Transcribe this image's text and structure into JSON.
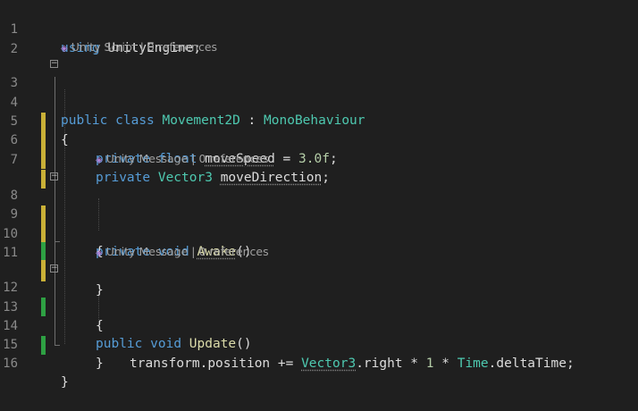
{
  "lines": [
    {
      "n": "1",
      "tokens": [
        {
          "t": "using",
          "c": "kw"
        },
        {
          "t": " UnityEngine;",
          "c": "id"
        }
      ]
    },
    {
      "n": "2",
      "tokens": []
    },
    {
      "n": "3",
      "tokens": [
        {
          "t": "public",
          "c": "kw"
        },
        {
          "t": " ",
          "c": "id"
        },
        {
          "t": "class",
          "c": "kw"
        },
        {
          "t": " ",
          "c": "id"
        },
        {
          "t": "Movement2D",
          "c": "ty"
        },
        {
          "t": " : ",
          "c": "id"
        },
        {
          "t": "MonoBehaviour",
          "c": "ty"
        }
      ]
    },
    {
      "n": "4",
      "tokens": [
        {
          "t": "{",
          "c": "id"
        }
      ]
    },
    {
      "n": "5",
      "tokens": [
        {
          "t": "private",
          "c": "kw"
        },
        {
          "t": " ",
          "c": "id"
        },
        {
          "t": "float",
          "c": "kw"
        },
        {
          "t": " ",
          "c": "id"
        },
        {
          "t": "moveSpeed",
          "c": "id dotted"
        },
        {
          "t": " = ",
          "c": "id"
        },
        {
          "t": "3.0f",
          "c": "num"
        },
        {
          "t": ";",
          "c": "id"
        }
      ]
    },
    {
      "n": "6",
      "tokens": [
        {
          "t": "private",
          "c": "kw"
        },
        {
          "t": " ",
          "c": "id"
        },
        {
          "t": "Vector3",
          "c": "ty"
        },
        {
          "t": " ",
          "c": "id"
        },
        {
          "t": "moveDirection",
          "c": "id dotted"
        },
        {
          "t": ";",
          "c": "id"
        }
      ]
    },
    {
      "n": "7",
      "tokens": []
    },
    {
      "n": "8",
      "tokens": [
        {
          "t": "private",
          "c": "kw"
        },
        {
          "t": " ",
          "c": "id"
        },
        {
          "t": "void",
          "c": "kw"
        },
        {
          "t": " ",
          "c": "id"
        },
        {
          "t": "Awake",
          "c": "fn dotted"
        },
        {
          "t": "()",
          "c": "id"
        }
      ]
    },
    {
      "n": "9",
      "tokens": [
        {
          "t": "{",
          "c": "id"
        }
      ]
    },
    {
      "n": "10",
      "tokens": []
    },
    {
      "n": "11",
      "tokens": [
        {
          "t": "}",
          "c": "id"
        }
      ]
    },
    {
      "n": "12",
      "tokens": [
        {
          "t": "public",
          "c": "kw"
        },
        {
          "t": " ",
          "c": "id"
        },
        {
          "t": "void",
          "c": "kw"
        },
        {
          "t": " ",
          "c": "id"
        },
        {
          "t": "Update",
          "c": "fn"
        },
        {
          "t": "()",
          "c": "id"
        }
      ]
    },
    {
      "n": "13",
      "tokens": [
        {
          "t": "{",
          "c": "id"
        }
      ]
    },
    {
      "n": "14",
      "tokens": [
        {
          "t": "transform",
          "c": "id"
        },
        {
          "t": ".",
          "c": "id"
        },
        {
          "t": "position",
          "c": "id"
        },
        {
          "t": " += ",
          "c": "id"
        },
        {
          "t": "Vector3",
          "c": "ty dotted"
        },
        {
          "t": ".",
          "c": "id"
        },
        {
          "t": "right",
          "c": "id"
        },
        {
          "t": " * ",
          "c": "id"
        },
        {
          "t": "1",
          "c": "num"
        },
        {
          "t": " * ",
          "c": "id"
        },
        {
          "t": "Time",
          "c": "ty"
        },
        {
          "t": ".",
          "c": "id"
        },
        {
          "t": "deltaTime",
          "c": "id"
        },
        {
          "t": ";",
          "c": "id"
        }
      ]
    },
    {
      "n": "15",
      "tokens": [
        {
          "t": "}",
          "c": "id"
        }
      ]
    },
    {
      "n": "16",
      "tokens": [
        {
          "t": "}",
          "c": "id"
        }
      ]
    }
  ],
  "codelens": {
    "script": "Unity Script | 0 references",
    "awake": "Unity Message | 0 references",
    "update": "Unity Message | 0 references"
  }
}
